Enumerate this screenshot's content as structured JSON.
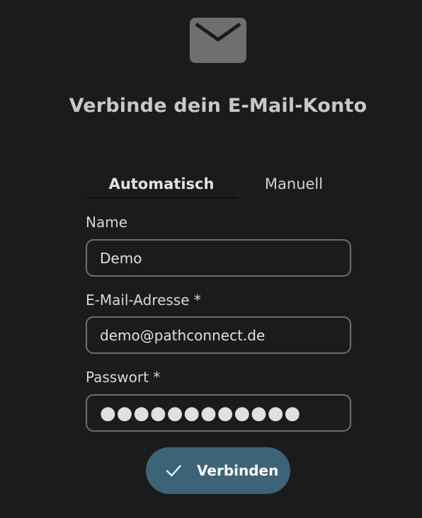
{
  "header": {
    "icon": "mail-icon",
    "title": "Verbinde dein E-Mail-Konto"
  },
  "tabs": [
    {
      "label": "Automatisch",
      "active": true
    },
    {
      "label": "Manuell",
      "active": false
    }
  ],
  "form": {
    "name": {
      "label": "Name",
      "value": "Demo"
    },
    "email": {
      "label": "E-Mail-Adresse *",
      "value": "demo@pathconnect.de"
    },
    "password": {
      "label": "Passwort *",
      "value": "●●●●●●●●●●●●"
    }
  },
  "submit": {
    "label": "Verbinden",
    "icon": "check-icon"
  },
  "colors": {
    "background": "#1b1b1b",
    "button": "#3c6477",
    "icon": "#6f6f6f",
    "field_border": "#6e6e6e"
  }
}
